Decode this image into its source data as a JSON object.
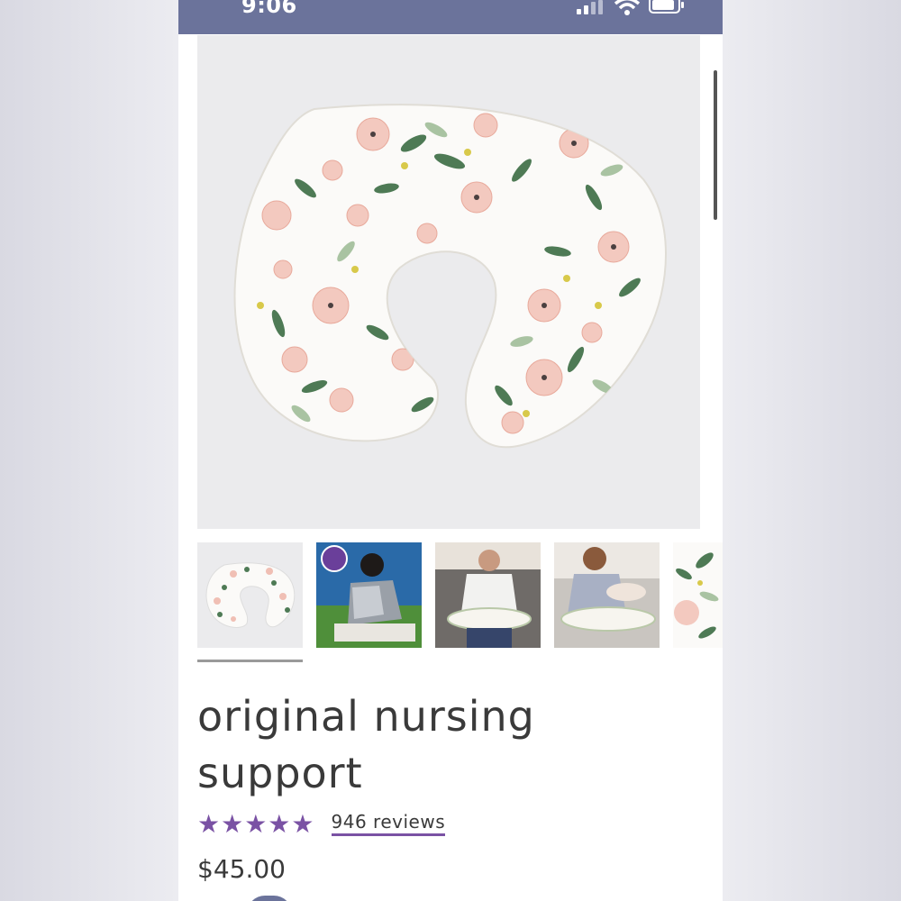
{
  "status_bar": {
    "time": "9:06",
    "icons": [
      "cellular-signal-icon",
      "wifi-icon",
      "battery-icon"
    ],
    "color": "#6b739b"
  },
  "product": {
    "title": "original nursing support",
    "rating_stars": 5,
    "reviews_label": "946 reviews",
    "price": "$45.00",
    "star_color": "#7a52a4"
  },
  "gallery": {
    "selected_index": 0,
    "thumbnails": [
      {
        "name": "floral-pillow"
      },
      {
        "name": "nursing-cover-mother"
      },
      {
        "name": "father-feeding-baby"
      },
      {
        "name": "mother-nursing-baby"
      },
      {
        "name": "floral-pattern-closeup"
      }
    ]
  }
}
